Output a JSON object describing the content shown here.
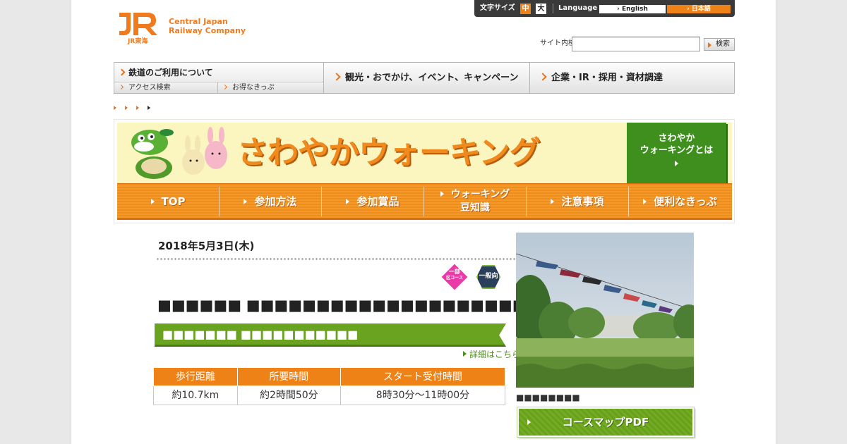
{
  "header": {
    "logo_mark": "JR",
    "logo_sub": "JR東海",
    "company_line1": "Central Japan",
    "company_line2": "Railway Company",
    "font_size_label": "文字サイズ",
    "font_size_medium": "中",
    "font_size_large": "大",
    "language_label": "Language",
    "lang_english": "English",
    "lang_japanese": "日本語",
    "search_label": "サイト内検索",
    "search_value": "",
    "search_button": "検索"
  },
  "global_nav": {
    "railway": "鉄道のご利用について",
    "access": "アクセス検索",
    "tickets": "お得なきっぷ",
    "tourism": "観光・おでかけ、イベント、キャンペーン",
    "corporate": "企業・IR・採用・資材調達"
  },
  "banner": {
    "title": "さわやかウォーキング",
    "what_is_line1": "さわやか",
    "what_is_line2": "ウォーキングとは",
    "nav": [
      {
        "label": "TOP"
      },
      {
        "label": "参加方法"
      },
      {
        "label": "参加賞品"
      },
      {
        "label": "ウォーキング",
        "label2": "豆知識"
      },
      {
        "label": "注意事項"
      },
      {
        "label": "便利なきっぷ"
      }
    ]
  },
  "event": {
    "date": "2018年5月3日(木)",
    "badge_1_line1": "一部",
    "badge_1_line2": "区コース",
    "badge_2": "一般向",
    "title": "■■■■■■ ■■■■■■■■■■■■■■■■■■■■■■■■■■■■■■",
    "course_name": "■■■■■■■ ■■■■■■■■■■■",
    "detail_link": "詳細はこちら",
    "table_headers": [
      "歩行距離",
      "所要時間",
      "スタート受付時間"
    ],
    "table_values": [
      "約10.7km",
      "約2時間50分",
      "8時30分～11時00分"
    ],
    "photo_caption": "■■■■■■■■",
    "pdf_button": "コースマップPDF"
  },
  "colors": {
    "accent_orange": "#ee8216",
    "accent_green": "#6aa320",
    "banner_bg": "#fbf5c0"
  }
}
